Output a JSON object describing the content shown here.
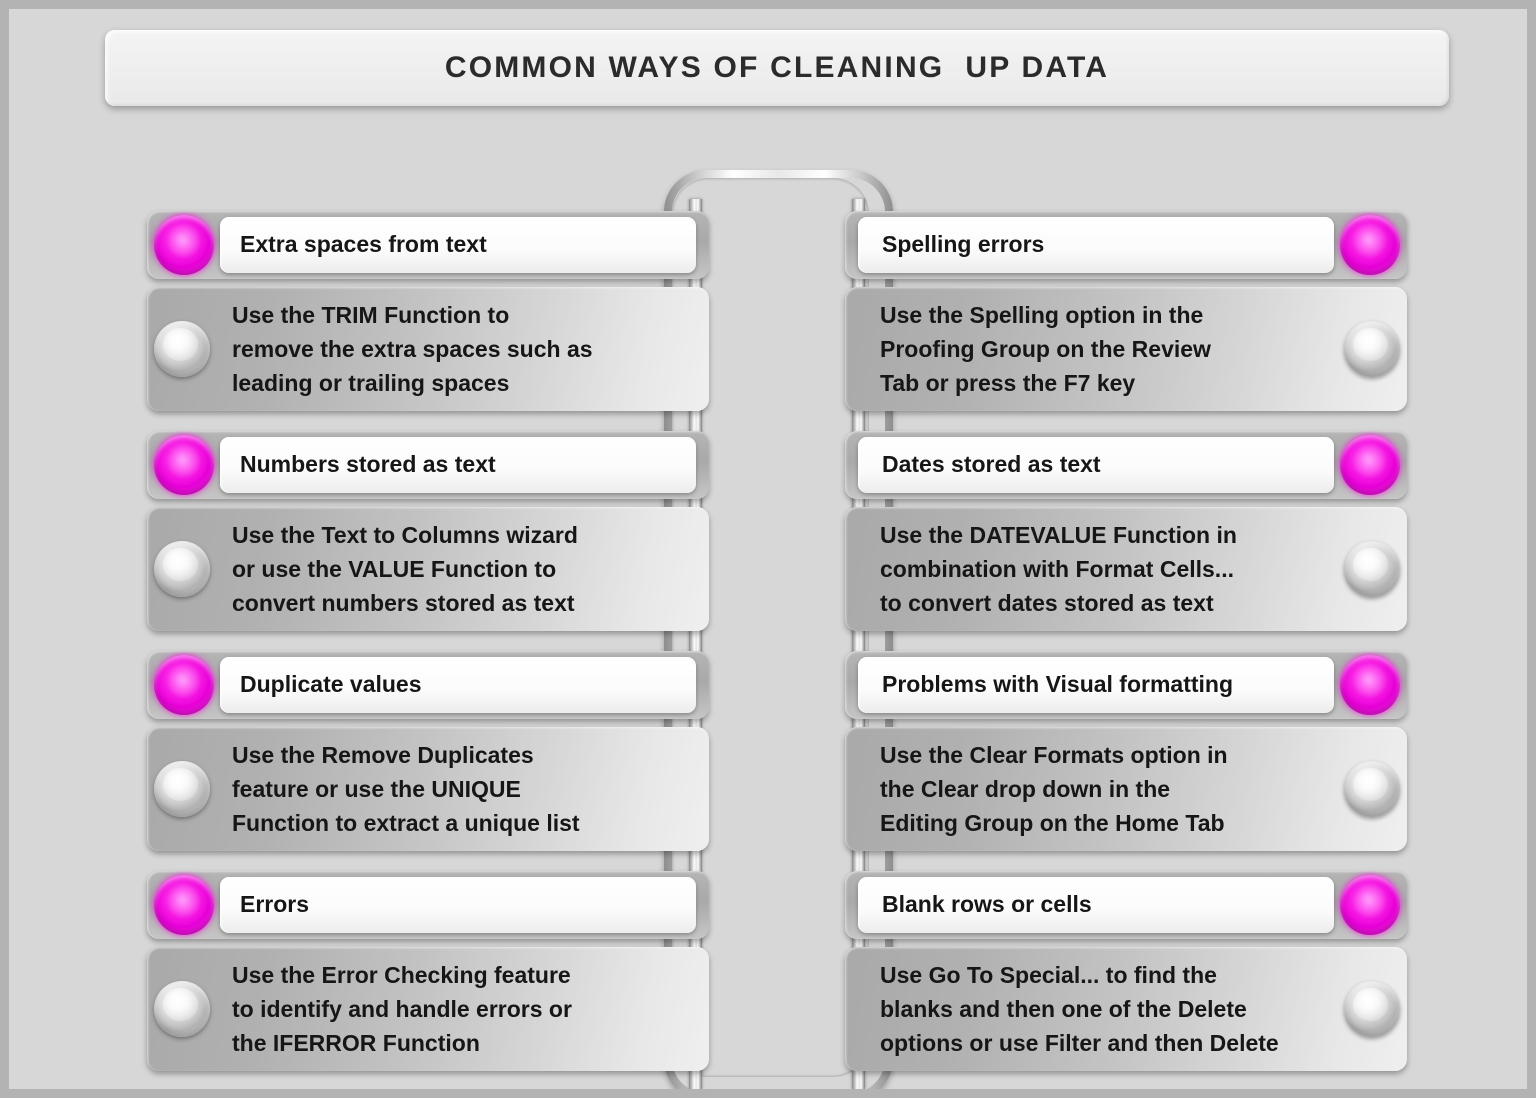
{
  "header": {
    "title": "COMMON WAYS OF CLEANING  UP DATA"
  },
  "colors": {
    "accent": "#ff00e6",
    "background": "#d7d7d7",
    "frame": "#b3b3b3",
    "card_gray": "#b5b5b5",
    "pill_white": "#ffffff",
    "text": "#161616"
  },
  "left_column": [
    {
      "bullet": "magenta-bullet-icon",
      "heading": "Extra spaces from text",
      "detail_bullet": "silver-bullet-icon",
      "detail_lines": [
        "Use the TRIM Function to",
        "remove the extra spaces such as",
        "leading or trailing spaces"
      ]
    },
    {
      "bullet": "magenta-bullet-icon",
      "heading": "Numbers stored as text",
      "detail_bullet": "silver-bullet-icon",
      "detail_lines": [
        "Use the Text to Columns wizard",
        "or use the VALUE Function to",
        "convert numbers stored as text"
      ]
    },
    {
      "bullet": "magenta-bullet-icon",
      "heading": "Duplicate values",
      "detail_bullet": "silver-bullet-icon",
      "detail_lines": [
        "Use the Remove Duplicates",
        "feature or use the UNIQUE",
        "Function to extract a unique list"
      ]
    },
    {
      "bullet": "magenta-bullet-icon",
      "heading": "Errors",
      "detail_bullet": "silver-bullet-icon",
      "detail_lines": [
        "Use the Error Checking feature",
        "to identify and handle errors or",
        "the IFERROR Function"
      ]
    }
  ],
  "right_column": [
    {
      "bullet": "magenta-bullet-icon",
      "heading": "Spelling errors",
      "detail_bullet": "silver-bullet-icon",
      "detail_lines": [
        "Use the Spelling option in the",
        "Proofing Group on the Review",
        "Tab or press the F7 key"
      ]
    },
    {
      "bullet": "magenta-bullet-icon",
      "heading": "Dates stored as text",
      "detail_bullet": "silver-bullet-icon",
      "detail_lines": [
        "Use the DATEVALUE Function in",
        "combination with Format Cells...",
        "to convert dates stored as text"
      ]
    },
    {
      "bullet": "magenta-bullet-icon",
      "heading": "Problems with Visual formatting",
      "detail_bullet": "silver-bullet-icon",
      "detail_lines": [
        "Use the Clear Formats option in",
        "the Clear drop down in the",
        "Editing Group on the Home Tab"
      ]
    },
    {
      "bullet": "magenta-bullet-icon",
      "heading": "Blank rows or cells",
      "detail_bullet": "silver-bullet-icon",
      "detail_lines": [
        "Use Go To Special... to find the",
        "blanks and then one of the Delete",
        "options or use Filter and then Delete"
      ]
    }
  ]
}
